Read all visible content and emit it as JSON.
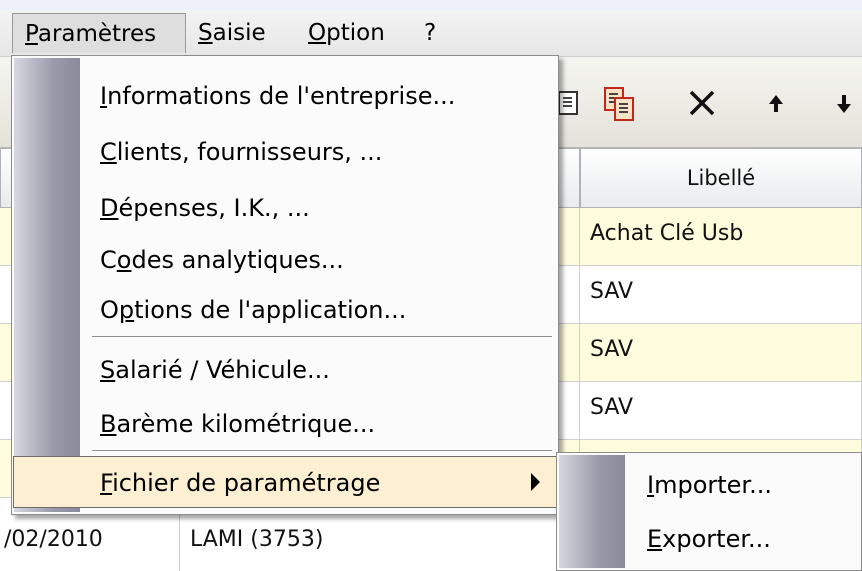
{
  "menubar": {
    "items": [
      {
        "pre": "",
        "key": "P",
        "post": "aramètres"
      },
      {
        "pre": "",
        "key": "S",
        "post": "aisie"
      },
      {
        "pre": "",
        "key": "O",
        "post": "ption"
      },
      {
        "pre": "",
        "key": "",
        "post": "?"
      }
    ]
  },
  "menu": {
    "items": [
      {
        "pre": "",
        "key": "I",
        "post": "nformations de l'entreprise..."
      },
      {
        "pre": "",
        "key": "C",
        "post": "lients, fournisseurs, ..."
      },
      {
        "pre": "",
        "key": "D",
        "post": "épenses, I.K., ..."
      },
      {
        "pre": "C",
        "key": "o",
        "post": "des analytiques..."
      },
      {
        "pre": "O",
        "key": "p",
        "post": "tions de l'application..."
      },
      {
        "pre": "",
        "key": "S",
        "post": "alarié / Véhicule..."
      },
      {
        "pre": "",
        "key": "B",
        "post": "arème kilométrique..."
      },
      {
        "pre": "",
        "key": "F",
        "post": "ichier de paramétrage"
      }
    ]
  },
  "submenu": {
    "items": [
      {
        "pre": "",
        "key": "I",
        "post": "mporter..."
      },
      {
        "pre": "",
        "key": "E",
        "post": "xporter..."
      }
    ]
  },
  "grid": {
    "header_libelle": "Libellé",
    "rows": [
      {
        "libelle": "Achat Clé Usb"
      },
      {
        "libelle": "SAV"
      },
      {
        "libelle": "SAV"
      },
      {
        "libelle": "SAV"
      }
    ],
    "last_row": {
      "date": "/02/2010",
      "tiers": "LAMI (3753)"
    }
  },
  "toolbar": {
    "icons": [
      "copy-icon",
      "paste-icon",
      "delete-icon",
      "move-up-icon",
      "move-down-icon"
    ]
  },
  "colors": {
    "row_highlight": "#fefcdc",
    "menu_selection": "#fcefd2"
  }
}
